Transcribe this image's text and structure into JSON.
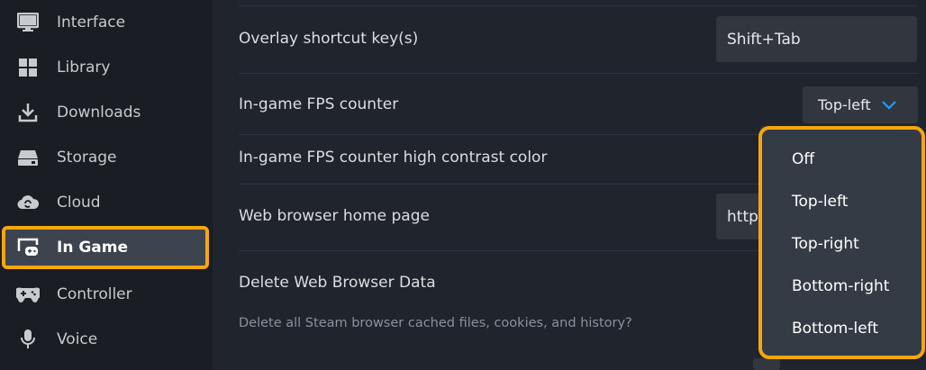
{
  "sidebar": {
    "items": [
      {
        "label": "Interface",
        "icon": "monitor-icon"
      },
      {
        "label": "Library",
        "icon": "grid-icon"
      },
      {
        "label": "Downloads",
        "icon": "download-icon"
      },
      {
        "label": "Storage",
        "icon": "drive-icon"
      },
      {
        "label": "Cloud",
        "icon": "cloud-sync-icon"
      },
      {
        "label": "In Game",
        "icon": "gamepad-window-icon",
        "active": true
      },
      {
        "label": "Controller",
        "icon": "controller-icon"
      },
      {
        "label": "Voice",
        "icon": "microphone-icon"
      }
    ]
  },
  "settings": {
    "overlay_shortcut": {
      "label": "Overlay shortcut key(s)",
      "value": "Shift+Tab"
    },
    "fps_counter": {
      "label": "In-game FPS counter",
      "value": "Top-left"
    },
    "fps_high_contrast": {
      "label": "In-game FPS counter high contrast color"
    },
    "browser_home": {
      "label": "Web browser home page",
      "value": "http"
    },
    "delete_browser_data": {
      "label": "Delete Web Browser Data",
      "description": "Delete all Steam browser cached files, cookies, and history?"
    }
  },
  "fps_menu": {
    "options": [
      "Off",
      "Top-left",
      "Top-right",
      "Bottom-right",
      "Bottom-left"
    ],
    "selected": "Top-left"
  },
  "colors": {
    "highlight": "#f5a70d",
    "accent_chevron": "#1a9fff",
    "sidebar_bg": "#1a1d23",
    "main_bg": "#1f242d"
  }
}
